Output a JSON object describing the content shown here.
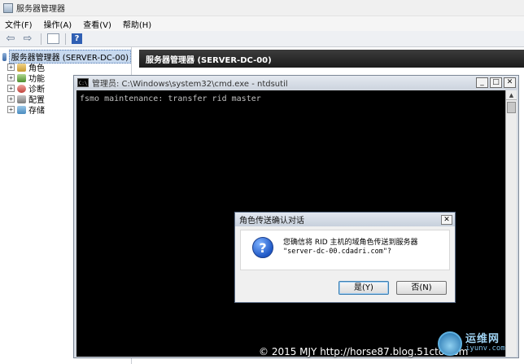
{
  "window": {
    "title": "服务器管理器"
  },
  "menu": [
    "文件(F)",
    "操作(A)",
    "查看(V)",
    "帮助(H)"
  ],
  "toolbar": {
    "help_label": "?"
  },
  "tree": {
    "root": "服务器管理器 (SERVER-DC-00)",
    "items": [
      "角色",
      "功能",
      "诊断",
      "配置",
      "存储"
    ]
  },
  "right_header": "服务器管理器 (SERVER-DC-00)",
  "cmd": {
    "title": "管理员: C:\\Windows\\system32\\cmd.exe - ntdsutil",
    "icon_text": "C:\\",
    "output": "fsmo maintenance: transfer rid master"
  },
  "dialog": {
    "title": "角色传送确认对话",
    "line1": "您确信将 RID 主机的域角色传送到服务器",
    "line2": "\"server-dc-00.cdadri.com\"?",
    "yes": "是(Y)",
    "no": "否(N)"
  },
  "watermark": {
    "text": "© 2015 MJY http://horse87.blog.51cto.com",
    "logo_text": "运维网",
    "logo_sub": "iyunv.com"
  },
  "colors": {
    "header_bg": "#1c1c1c",
    "console_bg": "#000000",
    "console_fg": "#c0c0c0",
    "question_icon": "#1f58c6"
  }
}
